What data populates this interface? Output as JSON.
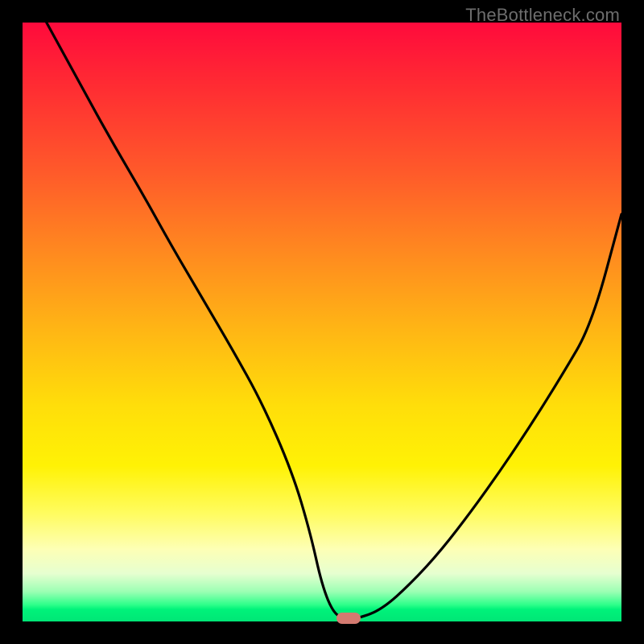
{
  "watermark": "TheBottleneck.com",
  "chart_data": {
    "type": "line",
    "title": "",
    "xlabel": "",
    "ylabel": "",
    "xlim": [
      0,
      100
    ],
    "ylim": [
      0,
      100
    ],
    "grid": false,
    "legend": false,
    "x": [
      4,
      10,
      15,
      20,
      25,
      30,
      35,
      40,
      45,
      48,
      50,
      52,
      54,
      56,
      60,
      65,
      70,
      75,
      80,
      85,
      90,
      95,
      100
    ],
    "y": [
      100,
      89,
      80,
      71.5,
      62.5,
      54,
      45.5,
      36.5,
      25,
      15,
      6,
      1.2,
      0.5,
      0.5,
      2,
      6.5,
      12,
      18.5,
      25.5,
      33,
      41,
      49.5,
      68
    ],
    "annotations": [
      {
        "kind": "marker",
        "shape": "rounded-rect",
        "x": 54.5,
        "y": 0.5,
        "color": "#d47a70"
      }
    ],
    "note": "x and y expressed as percent of plot width/height; y=0 is bottom (green), y=100 is top (red)."
  },
  "colors": {
    "frame": "#000000",
    "curve": "#000000",
    "marker": "#d47a70",
    "watermark": "#6d6d6d"
  }
}
